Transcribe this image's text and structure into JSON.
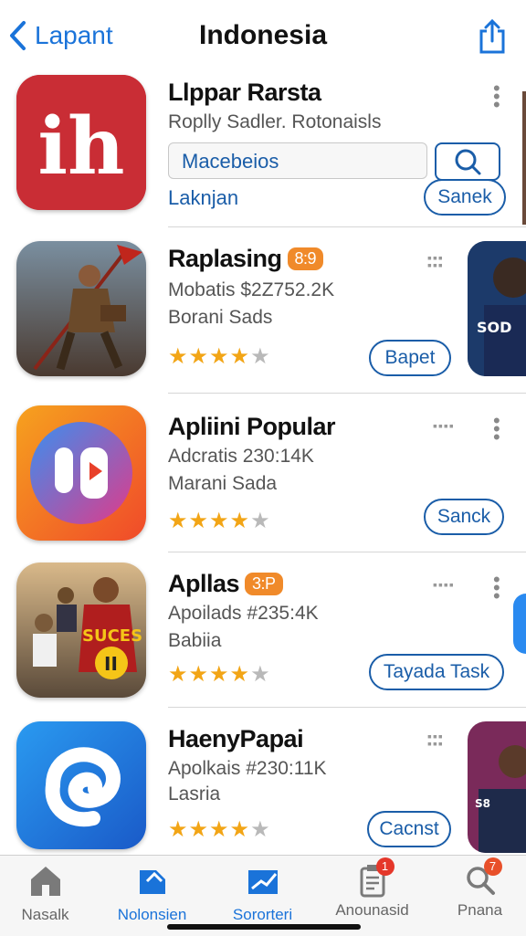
{
  "header": {
    "back_label": "Lapant",
    "title": "Indonesia"
  },
  "apps": [
    {
      "name": "Llppar Rarsta",
      "subtitle": "Roplly Sadler. Rotonaisls",
      "search_value": "Macebeios",
      "link": "Laknjan",
      "action": "Sanek"
    },
    {
      "name": "Raplasing",
      "badge": "8:9",
      "line1": "Mobatis $2Z752.2K",
      "line2": "Borani Sads",
      "rating": 4,
      "action": "Bapet"
    },
    {
      "name": "Apliini Popular",
      "line1": "Adcratis 230:14K",
      "line2": "Marani Sada",
      "rating": 4,
      "action": "Sanck"
    },
    {
      "name": "Apllas",
      "badge": "3:P",
      "line1": "Apoilads #235:4K",
      "line2": "Babiia",
      "rating": 4,
      "action": "Tayada Task"
    },
    {
      "name": "HaenyPapai",
      "line1": "Apolkais #230:11K",
      "line2": "Lasria",
      "rating": 4,
      "action": "Cacnst"
    }
  ],
  "tabs": [
    {
      "label": "Nasalk",
      "icon": "home-icon",
      "active": false
    },
    {
      "label": "Nolonsien",
      "icon": "tag-icon",
      "active": true
    },
    {
      "label": "Sororteri",
      "icon": "chart-icon",
      "active": true
    },
    {
      "label": "Anounasid",
      "icon": "clipboard-icon",
      "active": false,
      "badge": "1"
    },
    {
      "label": "Pnana",
      "icon": "search-icon",
      "active": false,
      "badge": "7"
    }
  ],
  "colors": {
    "accent": "#1a73d9",
    "link": "#1a5da8",
    "star": "#f2a516",
    "badge": "#f08a2a",
    "notification": "#e5372a"
  }
}
